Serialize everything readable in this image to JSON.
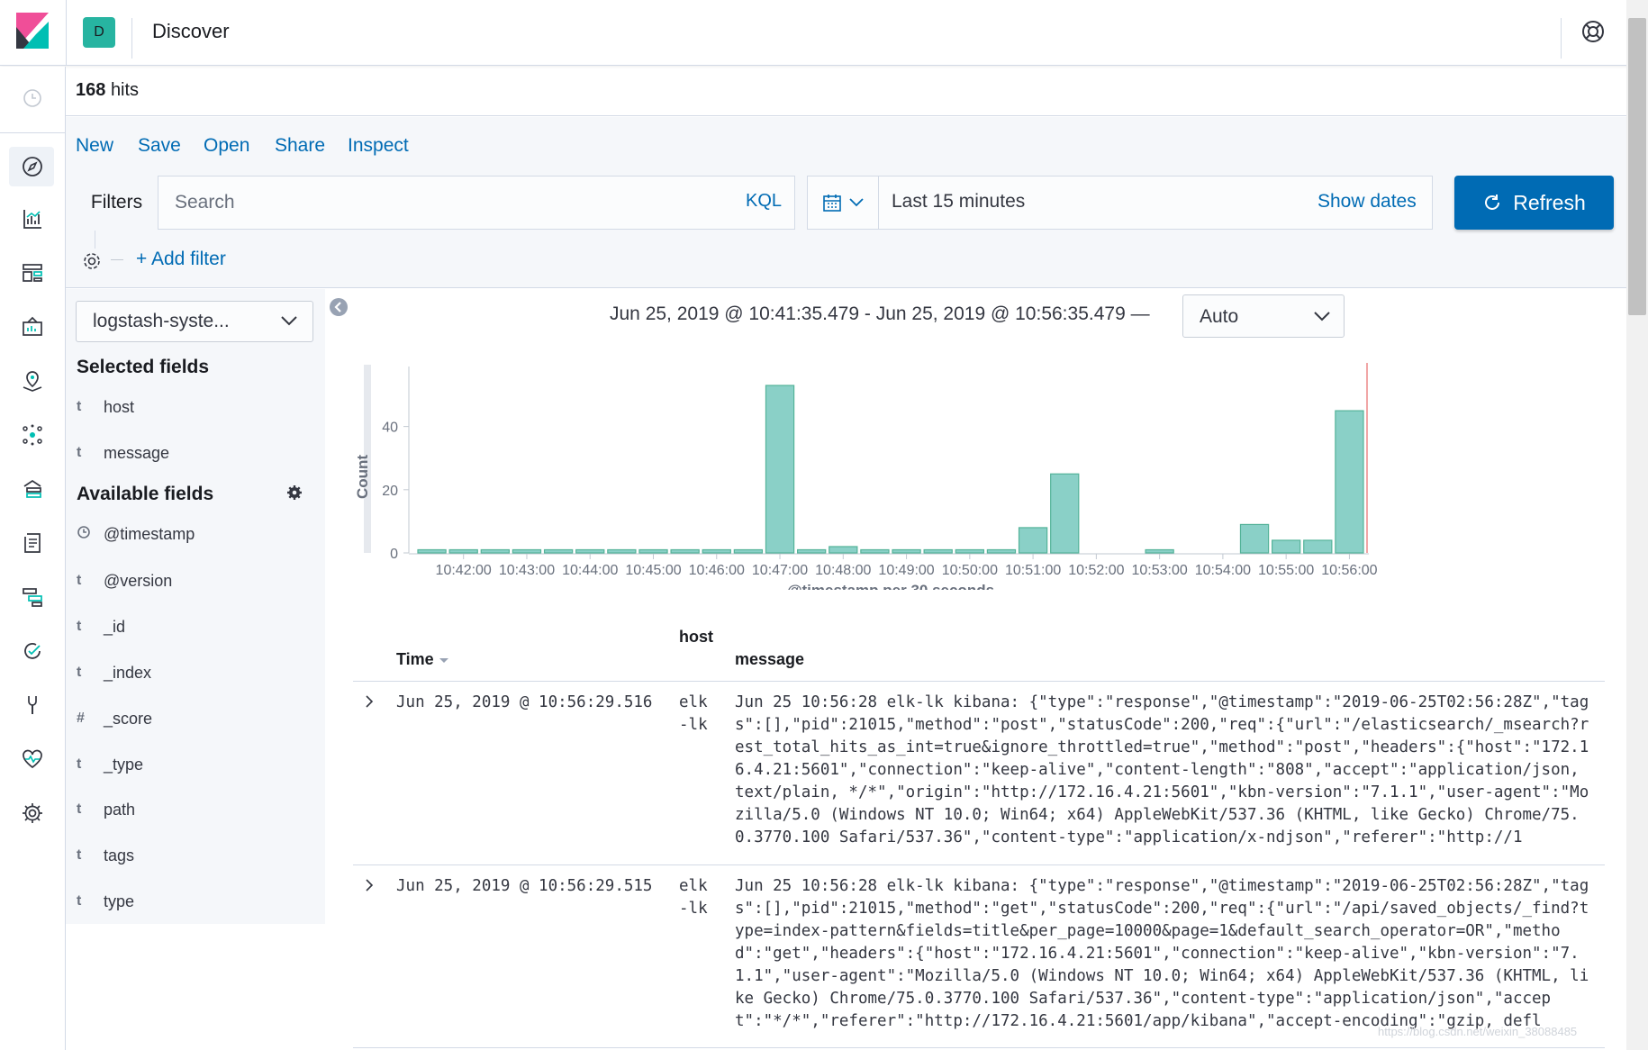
{
  "header": {
    "app_title": "Discover",
    "space_initial": "D"
  },
  "hits": {
    "count": "168",
    "label": "hits"
  },
  "top_nav": {
    "new": "New",
    "save": "Save",
    "open": "Open",
    "share": "Share",
    "inspect": "Inspect"
  },
  "query": {
    "filters_label": "Filters",
    "search_placeholder": "Search",
    "kql_label": "KQL",
    "time_label": "Last 15 minutes",
    "show_dates": "Show dates",
    "refresh_label": "Refresh",
    "add_filter": "+ Add filter"
  },
  "sidebar": {
    "index_pattern": "logstash-syste...",
    "selected_title": "Selected fields",
    "selected_fields": [
      {
        "type": "t",
        "name": "host"
      },
      {
        "type": "t",
        "name": "message"
      }
    ],
    "available_title": "Available fields",
    "available_fields": [
      {
        "type": "clock",
        "name": "@timestamp"
      },
      {
        "type": "t",
        "name": "@version"
      },
      {
        "type": "t",
        "name": "_id"
      },
      {
        "type": "t",
        "name": "_index"
      },
      {
        "type": "#",
        "name": "_score"
      },
      {
        "type": "t",
        "name": "_type"
      },
      {
        "type": "t",
        "name": "path"
      },
      {
        "type": "t",
        "name": "tags"
      },
      {
        "type": "t",
        "name": "type"
      }
    ]
  },
  "chart_header": {
    "time_range": "Jun 25, 2019 @ 10:41:35.479 - Jun 25, 2019 @ 10:56:35.479 —",
    "interval": "Auto"
  },
  "chart_data": {
    "type": "bar",
    "xlabel": "@timestamp per 30 seconds",
    "ylabel": "Count",
    "ylim": [
      0,
      55
    ],
    "yticks": [
      0,
      20,
      40
    ],
    "tick_labels": [
      "10:42:00",
      "10:43:00",
      "10:44:00",
      "10:45:00",
      "10:46:00",
      "10:47:00",
      "10:48:00",
      "10:49:00",
      "10:50:00",
      "10:51:00",
      "10:52:00",
      "10:53:00",
      "10:54:00",
      "10:55:00",
      "10:56:00"
    ],
    "categories": [
      "10:41:30",
      "10:42:00",
      "10:42:30",
      "10:43:00",
      "10:43:30",
      "10:44:00",
      "10:44:30",
      "10:45:00",
      "10:45:30",
      "10:46:00",
      "10:46:30",
      "10:47:00",
      "10:47:30",
      "10:48:00",
      "10:48:30",
      "10:49:00",
      "10:49:30",
      "10:50:00",
      "10:50:30",
      "10:51:00",
      "10:51:30",
      "10:52:00",
      "10:52:30",
      "10:53:00",
      "10:53:30",
      "10:54:00",
      "10:54:30",
      "10:55:00",
      "10:55:30",
      "10:56:00"
    ],
    "values": [
      1,
      1,
      1,
      1,
      1,
      1,
      1,
      1,
      1,
      1,
      1,
      53,
      1,
      2,
      1,
      1,
      1,
      1,
      1,
      8,
      25,
      0,
      0,
      1,
      0,
      0,
      9,
      4,
      4,
      45
    ],
    "bar_color": "#8ad0c7",
    "bar_stroke": "#54b399",
    "now_marker_color": "#f1a6a6",
    "grid": false
  },
  "table": {
    "col_time": "Time",
    "col_host": "host",
    "col_message": "message",
    "rows": [
      {
        "time": "Jun 25, 2019 @ 10:56:29.516",
        "host": "elk-lk",
        "message": "Jun 25 10:56:28 elk-lk kibana: {\"type\":\"response\",\"@timestamp\":\"2019-06-25T02:56:28Z\",\"tags\":[],\"pid\":21015,\"method\":\"post\",\"statusCode\":200,\"req\":{\"url\":\"/elasticsearch/_msearch?rest_total_hits_as_int=true&ignore_throttled=true\",\"method\":\"post\",\"headers\":{\"host\":\"172.16.4.21:5601\",\"connection\":\"keep-alive\",\"content-length\":\"808\",\"accept\":\"application/json, text/plain, */*\",\"origin\":\"http://172.16.4.21:5601\",\"kbn-version\":\"7.1.1\",\"user-agent\":\"Mozilla/5.0 (Windows NT 10.0; Win64; x64) AppleWebKit/537.36 (KHTML, like Gecko) Chrome/75.0.3770.100 Safari/537.36\",\"content-type\":\"application/x-ndjson\",\"referer\":\"http://1"
      },
      {
        "time": "Jun 25, 2019 @ 10:56:29.515",
        "host": "elk-lk",
        "message": "Jun 25 10:56:28 elk-lk kibana: {\"type\":\"response\",\"@timestamp\":\"2019-06-25T02:56:28Z\",\"tags\":[],\"pid\":21015,\"method\":\"get\",\"statusCode\":200,\"req\":{\"url\":\"/api/saved_objects/_find?type=index-pattern&fields=title&per_page=10000&page=1&default_search_operator=OR\",\"method\":\"get\",\"headers\":{\"host\":\"172.16.4.21:5601\",\"connection\":\"keep-alive\",\"kbn-version\":\"7.1.1\",\"user-agent\":\"Mozilla/5.0 (Windows NT 10.0; Win64; x64) AppleWebKit/537.36 (KHTML, like Gecko) Chrome/75.0.3770.100 Safari/537.36\",\"content-type\":\"application/json\",\"accept\":\"*/*\",\"referer\":\"http://172.16.4.21:5601/app/kibana\",\"accept-encoding\":\"gzip, defl"
      }
    ]
  },
  "watermark": "https://blog.csdn.net/weixin_38088485"
}
